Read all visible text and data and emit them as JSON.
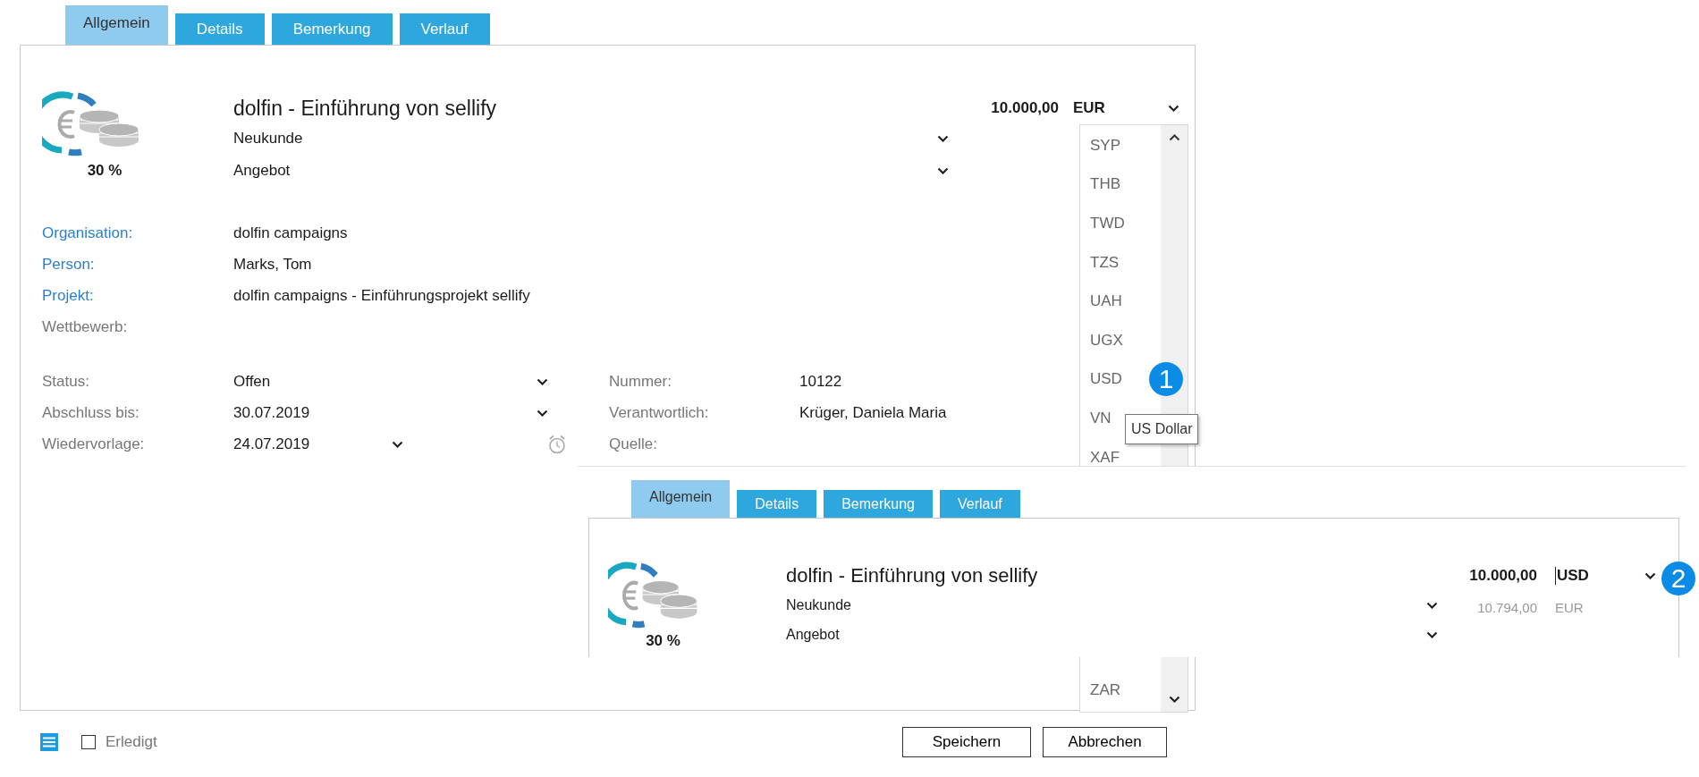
{
  "tabs": [
    {
      "label": "Allgemein",
      "selected": true
    },
    {
      "label": "Details",
      "selected": false
    },
    {
      "label": "Bemerkung",
      "selected": false
    },
    {
      "label": "Verlauf",
      "selected": false
    }
  ],
  "record": {
    "percent": "30 %",
    "title": "dolfin - Einführung von sellify",
    "amount": "10.000,00",
    "currency": "EUR",
    "type": "Neukunde",
    "phase": "Angebot"
  },
  "relations": [
    {
      "label": "Organisation:",
      "value": "dolfin campaigns",
      "linked": true
    },
    {
      "label": "Person:",
      "value": "Marks, Tom",
      "linked": true
    },
    {
      "label": "Projekt:",
      "value": "dolfin campaigns - Einführungsprojekt sellify",
      "linked": true
    },
    {
      "label": "Wettbewerb:",
      "linked": false
    }
  ],
  "fields_left": [
    {
      "label": "Status:",
      "value": "Offen",
      "kind": "dropdown"
    },
    {
      "label": "Abschluss bis:",
      "value": "30.07.2019",
      "kind": "dropdown"
    },
    {
      "label": "Wiedervorlage:",
      "value": "24.07.2019",
      "kind": "reminder"
    }
  ],
  "fields_right": [
    {
      "label": "Nummer:",
      "value": "10122"
    },
    {
      "label": "Verantwortlich:",
      "value": "Krüger, Daniela Maria"
    },
    {
      "label": "Quelle:"
    }
  ],
  "currency_list": {
    "items": [
      "SYP",
      "THB",
      "TWD",
      "TZS",
      "UAH",
      "UGX",
      "USD",
      "VN",
      "XAF"
    ],
    "bottom_items": [
      "ZAR"
    ],
    "callout": "1",
    "tooltip": "US Dollar"
  },
  "inset": {
    "tabs": [
      {
        "label": "Allgemein",
        "selected": true
      },
      {
        "label": "Details",
        "selected": false
      },
      {
        "label": "Bemerkung",
        "selected": false
      },
      {
        "label": "Verlauf",
        "selected": false
      }
    ],
    "record": {
      "percent": "30 %",
      "title": "dolfin - Einführung von sellify",
      "amount": "10.000,00",
      "currency": "USD",
      "converted_amount": "10.794,00",
      "converted_currency": "EUR",
      "type": "Neukunde",
      "phase": "Angebot"
    },
    "callout": "2"
  },
  "footer": {
    "done": {
      "label": "Erledigt",
      "checked": false
    },
    "buttons": [
      "Speichern",
      "Abbrechen"
    ]
  }
}
